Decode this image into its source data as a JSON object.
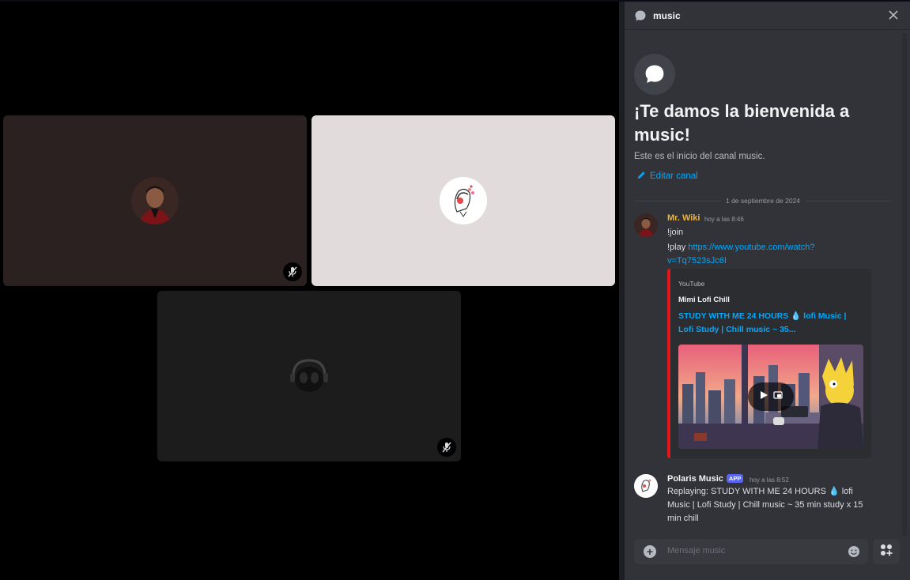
{
  "participants": [
    {
      "name": "mr-wiki-tile",
      "muted": true
    },
    {
      "name": "polaris-music-tile",
      "muted": false
    },
    {
      "name": "alien-headphones-tile",
      "muted": true
    }
  ],
  "panel": {
    "channel_name": "music",
    "welcome_title": "¡Te damos la bienvenida a music!",
    "welcome_subtitle": "Este es el inicio del canal music.",
    "edit_channel": "Editar canal",
    "date_separator": "1 de septiembre de 2024"
  },
  "messages": [
    {
      "author": "Mr. Wiki",
      "author_color": "#f0b232",
      "time": "hoy a las 8:46",
      "line1": "!join",
      "line2_prefix": "!play ",
      "line2_link_a": "https://www.youtube.com/watch?",
      "line2_link_b": "v=Tq7523sJc6I",
      "embed": {
        "provider": "YouTube",
        "author": "Mimi Lofi Chill",
        "title": "STUDY WITH ME 24 HOURS 💧 lofi Music | Lofi Study | Chill music ~ 35...",
        "accent_color": "#e3161b"
      }
    },
    {
      "author": "Polaris Music",
      "author_color": "#f2f3f5",
      "badge": "APP",
      "time": "hoy a las 8:52",
      "text": "Replaying: STUDY WITH ME 24 HOURS 💧 lofi Music | Lofi Study | Chill music ~ 35 min study x 15 min chill"
    }
  ],
  "composer": {
    "placeholder": "Mensaje music"
  },
  "colors": {
    "panel_bg": "#313338",
    "link": "#00a8fc",
    "brand": "#5865f2"
  }
}
